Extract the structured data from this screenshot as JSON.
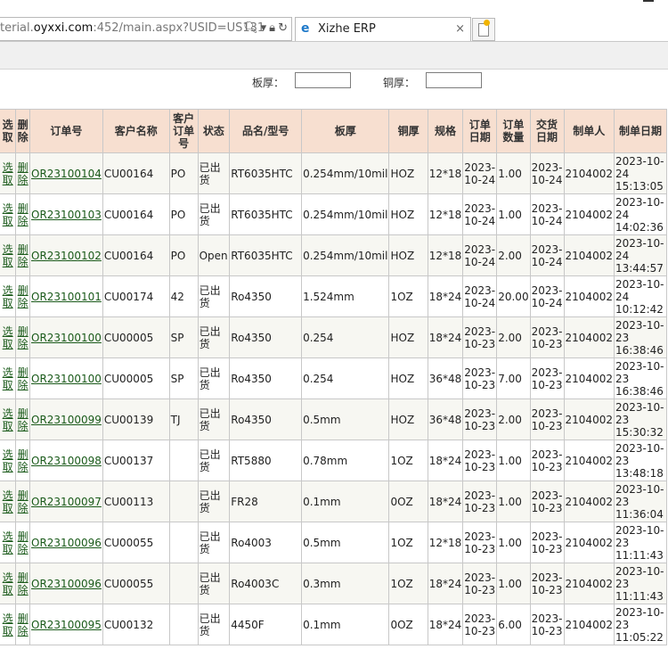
{
  "browser": {
    "url_prefix": "terial.",
    "url_host": "oyxxi.com",
    "url_rest": ":452/main.aspx?USID=US131",
    "tab_title": "Xizhe ERP",
    "tab_close": "×",
    "icons": [
      "search-icon",
      "dropdown-icon",
      "lock-icon",
      "refresh-icon",
      "ie-icon",
      "close-icon",
      "new-tab-icon"
    ]
  },
  "filters": {
    "board_thickness_label": "板厚：",
    "board_thickness_value": "",
    "copper_thickness_label": "铜厚：",
    "copper_thickness_value": ""
  },
  "table": {
    "headers": {
      "select": "选取",
      "delete": "删除",
      "order_no": "订单号",
      "customer_name": "客户名称",
      "customer_order_no": "客户订单号",
      "status": "状态",
      "product": "品名/型号",
      "board_thickness": "板厚",
      "copper_thickness": "铜厚",
      "spec": "规格",
      "order_date": "订单日期",
      "order_qty": "订单数量",
      "delivery_date": "交货日期",
      "creator": "制单人",
      "created_at": "制单日期"
    },
    "select_label": "选取",
    "delete_label": "删除",
    "rows": [
      {
        "order_no": "OR23100104",
        "customer": "CU00164",
        "cust_order": "PO",
        "status": "已出货",
        "product": "RT6035HTC",
        "board": "0.254mm/10mil",
        "copper": "HOZ",
        "spec": "12*18",
        "order_date": "2023-10-24",
        "qty": "1.00",
        "delivery": "2023-10-24",
        "creator": "2104002",
        "created": "2023-10-24 15:13:05"
      },
      {
        "order_no": "OR23100103",
        "customer": "CU00164",
        "cust_order": "PO",
        "status": "已出货",
        "product": "RT6035HTC",
        "board": "0.254mm/10mil",
        "copper": "HOZ",
        "spec": "12*18",
        "order_date": "2023-10-24",
        "qty": "1.00",
        "delivery": "2023-10-24",
        "creator": "2104002",
        "created": "2023-10-24 14:02:36"
      },
      {
        "order_no": "OR23100102",
        "customer": "CU00164",
        "cust_order": "PO",
        "status": "Open",
        "product": "RT6035HTC",
        "board": "0.254mm/10mil",
        "copper": "HOZ",
        "spec": "12*18",
        "order_date": "2023-10-24",
        "qty": "2.00",
        "delivery": "2023-10-24",
        "creator": "2104002",
        "created": "2023-10-24 13:44:57"
      },
      {
        "order_no": "OR23100101",
        "customer": "CU00174",
        "cust_order": "42",
        "status": "已出货",
        "product": "Ro4350",
        "board": "1.524mm",
        "copper": "1OZ",
        "spec": "18*24",
        "order_date": "2023-10-24",
        "qty": "20.00",
        "delivery": "2023-10-24",
        "creator": "2104002",
        "created": "2023-10-24 10:12:42"
      },
      {
        "order_no": "OR23100100",
        "customer": "CU00005",
        "cust_order": "SP",
        "status": "已出货",
        "product": "Ro4350",
        "board": "0.254",
        "copper": "HOZ",
        "spec": "18*24",
        "order_date": "2023-10-23",
        "qty": "2.00",
        "delivery": "2023-10-23",
        "creator": "2104002",
        "created": "2023-10-23 16:38:46"
      },
      {
        "order_no": "OR23100100",
        "customer": "CU00005",
        "cust_order": "SP",
        "status": "已出货",
        "product": "Ro4350",
        "board": "0.254",
        "copper": "HOZ",
        "spec": "36*48",
        "order_date": "2023-10-23",
        "qty": "7.00",
        "delivery": "2023-10-23",
        "creator": "2104002",
        "created": "2023-10-23 16:38:46"
      },
      {
        "order_no": "OR23100099",
        "customer": "CU00139",
        "cust_order": "TJ",
        "status": "已出货",
        "product": "Ro4350",
        "board": "0.5mm",
        "copper": "HOZ",
        "spec": "36*48",
        "order_date": "2023-10-23",
        "qty": "2.00",
        "delivery": "2023-10-23",
        "creator": "2104002",
        "created": "2023-10-23 15:30:32"
      },
      {
        "order_no": "OR23100098",
        "customer": "CU00137",
        "cust_order": "",
        "status": "已出货",
        "product": "RT5880",
        "board": "0.78mm",
        "copper": "1OZ",
        "spec": "18*24",
        "order_date": "2023-10-23",
        "qty": "1.00",
        "delivery": "2023-10-23",
        "creator": "2104002",
        "created": "2023-10-23 13:48:18"
      },
      {
        "order_no": "OR23100097",
        "customer": "CU00113",
        "cust_order": "",
        "status": "已出货",
        "product": "FR28",
        "board": "0.1mm",
        "copper": "0OZ",
        "spec": "18*24",
        "order_date": "2023-10-23",
        "qty": "1.00",
        "delivery": "2023-10-23",
        "creator": "2104002",
        "created": "2023-10-23 11:36:04"
      },
      {
        "order_no": "OR23100096",
        "customer": "CU00055",
        "cust_order": "",
        "status": "已出货",
        "product": "Ro4003",
        "board": "0.5mm",
        "copper": "1OZ",
        "spec": "12*18",
        "order_date": "2023-10-23",
        "qty": "1.00",
        "delivery": "2023-10-23",
        "creator": "2104002",
        "created": "2023-10-23 11:11:43"
      },
      {
        "order_no": "OR23100096",
        "customer": "CU00055",
        "cust_order": "",
        "status": "已出货",
        "product": "Ro4003C",
        "board": "0.3mm",
        "copper": "1OZ",
        "spec": "18*24",
        "order_date": "2023-10-23",
        "qty": "1.00",
        "delivery": "2023-10-23",
        "creator": "2104002",
        "created": "2023-10-23 11:11:43"
      },
      {
        "order_no": "OR23100095",
        "customer": "CU00132",
        "cust_order": "",
        "status": "已出货",
        "product": "4450F",
        "board": "0.1mm",
        "copper": "0OZ",
        "spec": "18*24",
        "order_date": "2023-10-23",
        "qty": "6.00",
        "delivery": "2023-10-23",
        "creator": "2104002",
        "created": "2023-10-23 11:05:22"
      }
    ]
  }
}
